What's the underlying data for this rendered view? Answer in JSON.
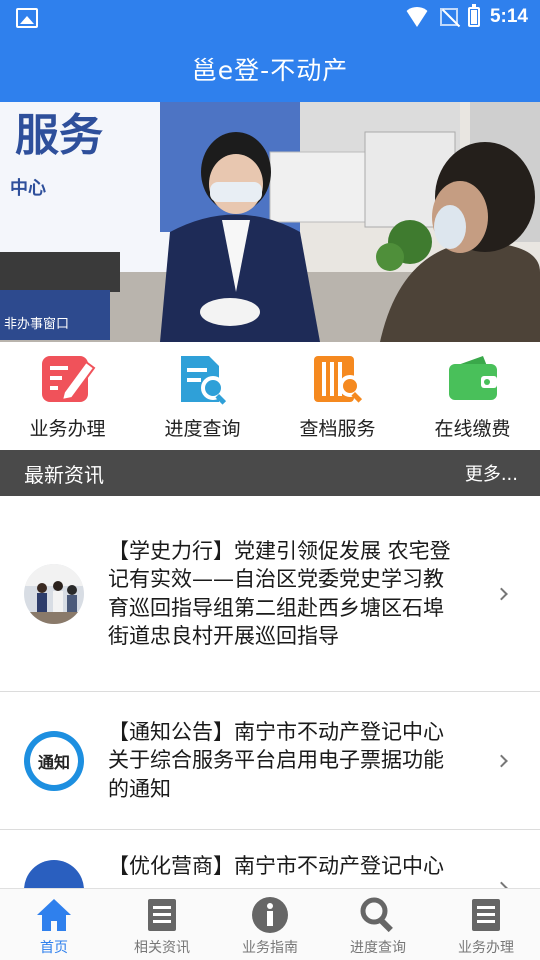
{
  "status": {
    "time": "5:14"
  },
  "header": {
    "title": "邕e登-不动产"
  },
  "banner": {
    "sign_text": "服务",
    "sign_sub": "中心",
    "window_sign": "非办事窗口"
  },
  "menu": [
    {
      "label": "业务办理",
      "icon": "edit-icon",
      "color": "#f0525a"
    },
    {
      "label": "进度查询",
      "icon": "document-search-icon",
      "color": "#2fa0d8"
    },
    {
      "label": "查档服务",
      "icon": "archive-search-icon",
      "color": "#f5891f"
    },
    {
      "label": "在线缴费",
      "icon": "wallet-icon",
      "color": "#49c05a"
    }
  ],
  "news_section": {
    "title": "最新资讯",
    "more": "更多..."
  },
  "news": [
    {
      "text": "【学史力行】党建引领促发展 农宅登记有实效——自治区党委党史学习教育巡回指导组第二组赴西乡塘区石埠街道忠良村开展巡回指导"
    },
    {
      "text": "【通知公告】南宁市不动产登记中心关于综合服务平台启用电子票据功能的通知",
      "thumb_text": "通知"
    },
    {
      "text": "【优化营商】南宁市不动产登记中心"
    }
  ],
  "tabs": [
    {
      "label": "首页",
      "icon": "home-icon",
      "active": true
    },
    {
      "label": "相关资讯",
      "icon": "news-icon"
    },
    {
      "label": "业务指南",
      "icon": "info-icon"
    },
    {
      "label": "进度查询",
      "icon": "search-icon"
    },
    {
      "label": "业务办理",
      "icon": "list-icon"
    }
  ],
  "colors": {
    "primary": "#2f80ed",
    "section_bg": "#4a4a4a"
  }
}
